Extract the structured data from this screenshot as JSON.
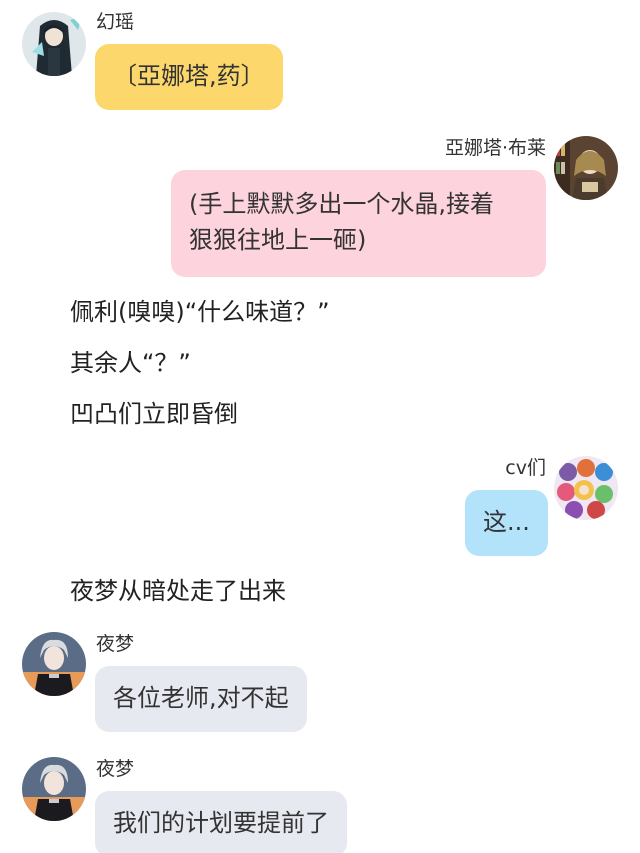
{
  "colors": {
    "yellow_bubble": "#fcd86c",
    "pink_bubble": "#fdd3dd",
    "blue_bubble": "#b3e2fb",
    "gray_bubble": "#e6e9ef"
  },
  "messages": {
    "m1": {
      "sender": "幻瑶",
      "text": "〔亞娜塔,药〕",
      "avatar": "dark-haired-character-avatar-icon"
    },
    "m2": {
      "sender": "亞娜塔·布莱",
      "line1": "(手上默默多出一个水晶,接着",
      "line2": "狠狠往地上一砸)",
      "avatar": "reading-girl-avatar-icon"
    },
    "m3": {
      "sender": "cv们",
      "text": "这...",
      "avatar": "group-characters-avatar-icon"
    },
    "m4": {
      "sender": "夜梦",
      "text": "各位老师,对不起",
      "avatar": "white-haired-boy-avatar-icon"
    },
    "m5": {
      "sender": "夜梦",
      "text": "我们的计划要提前了",
      "avatar": "white-haired-boy-avatar-icon"
    }
  },
  "narration": {
    "n1": "佩利(嗅嗅)“什么味道？”",
    "n2": "其余人“？”",
    "n3": "凹凸们立即昏倒",
    "n4": "夜梦从暗处走了出来"
  }
}
